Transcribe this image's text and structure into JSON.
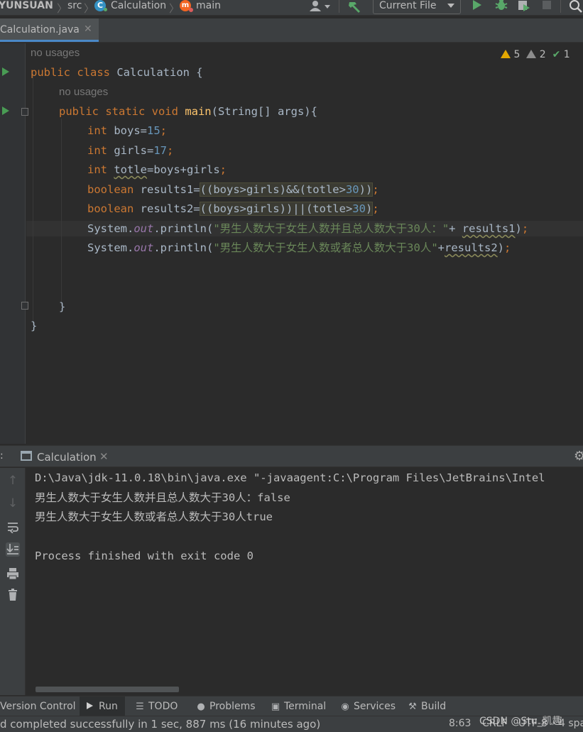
{
  "navbar": {
    "project": "YUNSUAN",
    "crumbs": [
      "src",
      "Calculation",
      "main"
    ],
    "class_icon_letter": "C",
    "method_icon_letter": "m",
    "run_config": "Current File"
  },
  "tabs": [
    {
      "label": "Calculation.java",
      "active": true
    }
  ],
  "inspections": {
    "warnings": "5",
    "weak_warnings": "2",
    "ok": "1"
  },
  "code": {
    "usage_hint": "no usages",
    "lines": [
      "public class Calculation {",
      "public static void main(String[] args){",
      "int boys=15;",
      "int girls=17;",
      "int totle=boys+girls;",
      "boolean results1=((boys>girls)&&(totle>30));",
      "boolean results2=((boys>girls))||(totle>30);",
      "System.out.println(\"男生人数大于女生人数并且总人数大于30人：\"+ results1);",
      "System.out.println(\"男生人数大于女生人数或者总人数大于30人\"+results2);",
      "}",
      "}"
    ]
  },
  "run_window": {
    "tab_label": "Calculation",
    "colon": ":",
    "console": [
      "D:\\Java\\jdk-11.0.18\\bin\\java.exe \"-javaagent:C:\\Program Files\\JetBrains\\Intel",
      "男生人数大于女生人数并且总人数大于30人：false",
      "男生人数大于女生人数或者总人数大于30人true",
      "",
      "Process finished with exit code 0"
    ]
  },
  "tool_windows": [
    {
      "label": "Version Control",
      "icon": "none"
    },
    {
      "label": "Run",
      "icon": "run-icon",
      "active": true
    },
    {
      "label": "TODO",
      "icon": "todo-icon"
    },
    {
      "label": "Problems",
      "icon": "problems-icon"
    },
    {
      "label": "Terminal",
      "icon": "terminal-icon"
    },
    {
      "label": "Services",
      "icon": "services-icon"
    },
    {
      "label": "Build",
      "icon": "build-icon"
    }
  ],
  "status": {
    "message": "d completed successfully in 1 sec, 887 ms (16 minutes ago)",
    "position": "8:63",
    "line_sep": "CRLF",
    "encoding": "UTF-8",
    "indent": "4 spa"
  },
  "watermark": "CSDN @Stu_凯趣",
  "colors": {
    "keyword": "#cc7832",
    "number": "#6897bb",
    "string": "#6a8759",
    "method": "#ffc66d",
    "field": "#9876aa",
    "run_green": "#59a869",
    "warning": "#e3a700"
  }
}
